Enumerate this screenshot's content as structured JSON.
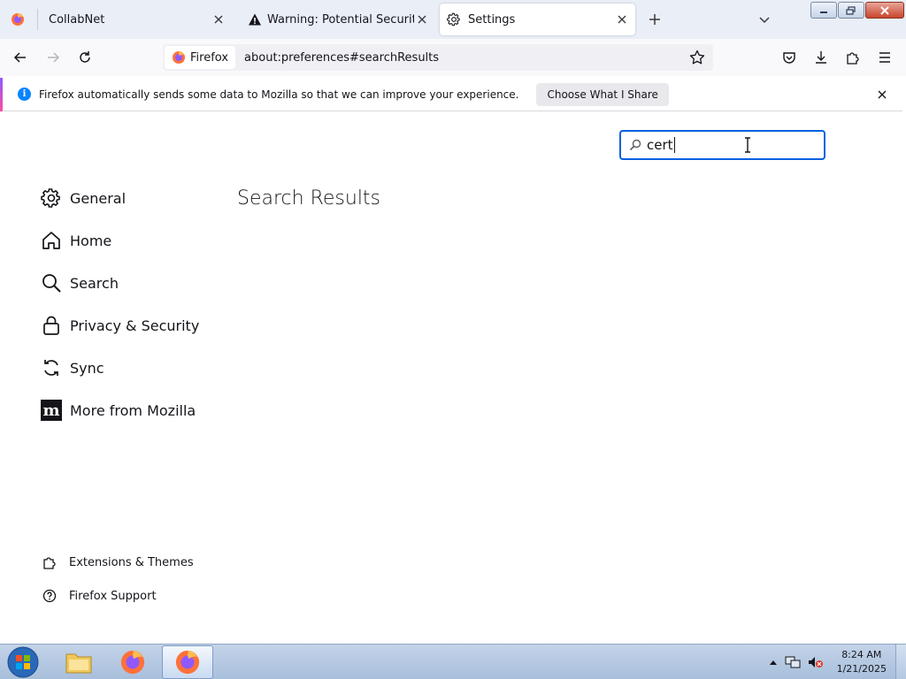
{
  "browser": {
    "tabs": [
      {
        "label": "CollabNet",
        "icon": "firefox-icon",
        "selected": false
      },
      {
        "label": "Warning: Potential Security Risk",
        "icon": "warning-icon",
        "selected": false
      },
      {
        "label": "Settings",
        "icon": "gear-icon",
        "selected": true
      }
    ],
    "identity_label": "Firefox",
    "url": "about:preferences#searchResults"
  },
  "notification": {
    "text": "Firefox automatically sends some data to Mozilla so that we can improve your experience.",
    "button_label": "Choose What I Share"
  },
  "settings": {
    "search_value": "cert",
    "page_title": "Search Results",
    "categories": [
      {
        "label": "General",
        "icon": "gear-icon"
      },
      {
        "label": "Home",
        "icon": "home-icon"
      },
      {
        "label": "Search",
        "icon": "search-icon"
      },
      {
        "label": "Privacy & Security",
        "icon": "lock-icon"
      },
      {
        "label": "Sync",
        "icon": "sync-icon"
      },
      {
        "label": "More from Mozilla",
        "icon": "mozilla-icon"
      }
    ],
    "footer": [
      {
        "label": "Extensions & Themes",
        "icon": "puzzle-icon"
      },
      {
        "label": "Firefox Support",
        "icon": "help-icon"
      }
    ]
  },
  "taskbar": {
    "time": "8:24 AM",
    "date": "1/21/2025"
  },
  "colors": {
    "focus_blue": "#0061e0",
    "info_blue": "#0a84ff",
    "text": "#15141a"
  }
}
